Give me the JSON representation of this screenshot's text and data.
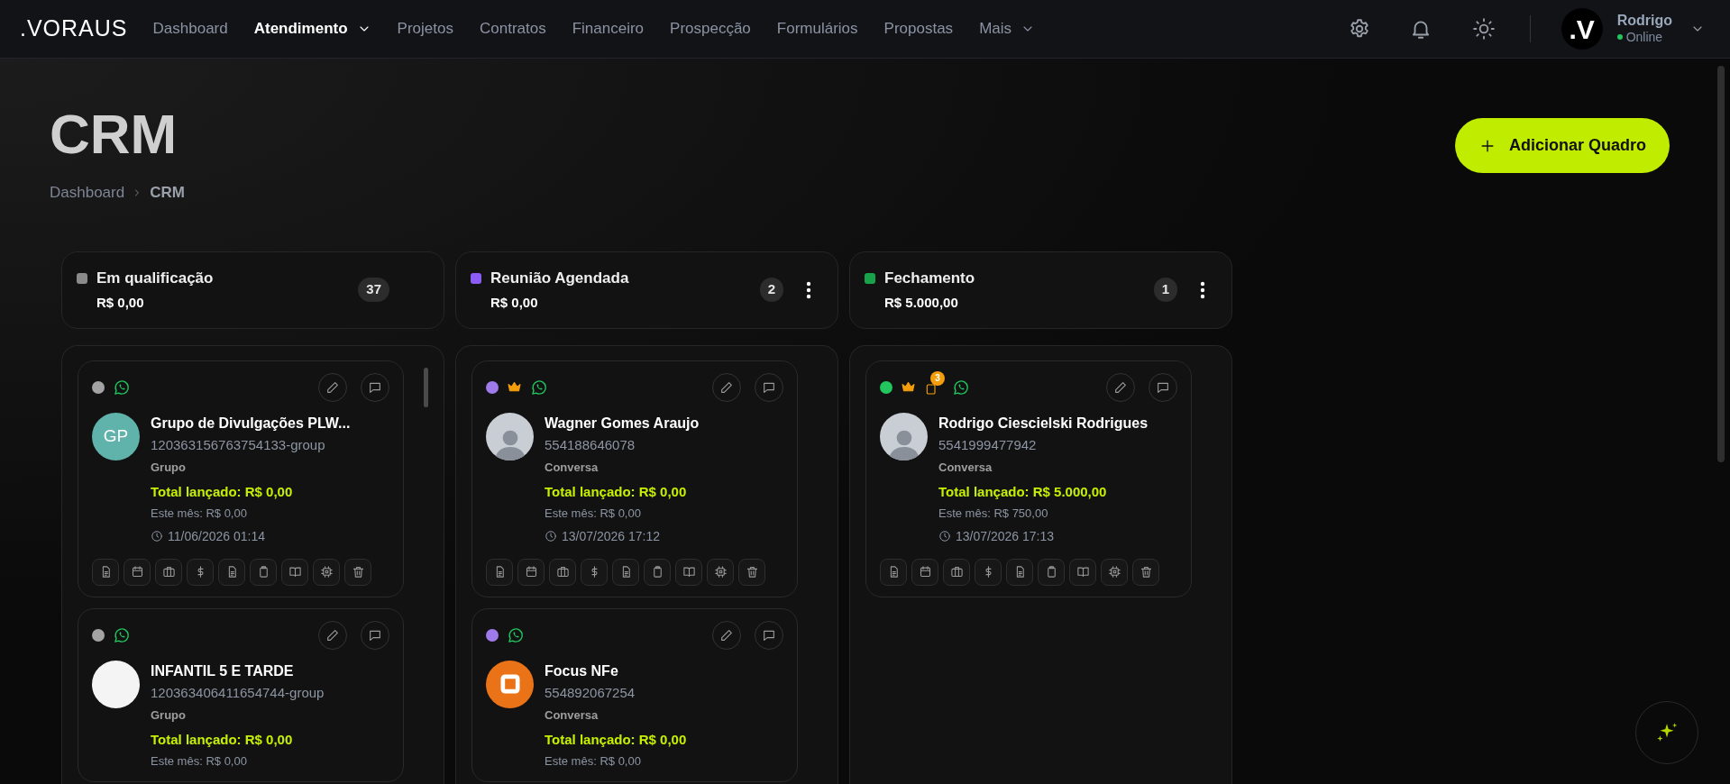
{
  "nav": {
    "logo": ".VORAUS",
    "items": [
      {
        "label": "Dashboard",
        "selected": false,
        "dropdown": false
      },
      {
        "label": "Atendimento",
        "selected": true,
        "dropdown": true
      },
      {
        "label": "Projetos",
        "selected": false,
        "dropdown": false
      },
      {
        "label": "Contratos",
        "selected": false,
        "dropdown": false
      },
      {
        "label": "Financeiro",
        "selected": false,
        "dropdown": false
      },
      {
        "label": "Prospecção",
        "selected": false,
        "dropdown": false
      },
      {
        "label": "Formulários",
        "selected": false,
        "dropdown": false
      },
      {
        "label": "Propostas",
        "selected": false,
        "dropdown": false
      },
      {
        "label": "Mais",
        "selected": false,
        "dropdown": true
      }
    ]
  },
  "user": {
    "avatar": ".V",
    "name": "Rodrigo",
    "status": "Online",
    "online": true
  },
  "page": {
    "title": "CRM",
    "breadcrumb": [
      "Dashboard",
      "CRM"
    ],
    "add_button": "Adicionar Quadro"
  },
  "columns": [
    {
      "title": "Em qualificação",
      "total": "R$ 0,00",
      "count": "37",
      "color": "#8a8a8a",
      "menu": false,
      "cards": [
        {
          "color": "#a3a3a3",
          "premium": false,
          "avatar": {
            "kind": "initials",
            "text": "GP",
            "color": "#5fb3aa"
          },
          "name": "Grupo de Divulgações PLW...",
          "phone": "120363156763754133-group",
          "type": "Grupo",
          "total": "Total lançado: R$ 0,00",
          "month": "Este mês: R$ 0,00",
          "date": "11/06/2026 01:14"
        },
        {
          "color": "#a3a3a3",
          "premium": false,
          "avatar": {
            "kind": "picture"
          },
          "name": "INFANTIL 5 E TARDE",
          "phone": "120363406411654744-group",
          "type": "Grupo",
          "total": "Total lançado: R$ 0,00",
          "month": "Este mês: R$ 0,00"
        }
      ]
    },
    {
      "title": "Reunião Agendada",
      "total": "R$ 0,00",
      "count": "2",
      "color": "#8b5cf6",
      "menu": true,
      "cards": [
        {
          "color": "#9f7aea",
          "premium": true,
          "avatar": {
            "kind": "photo"
          },
          "name": "Wagner Gomes Araujo",
          "phone": "554188646078",
          "type": "Conversa",
          "total": "Total lançado: R$ 0,00",
          "month": "Este mês: R$ 0,00",
          "date": "13/07/2026 17:12"
        },
        {
          "color": "#9f7aea",
          "premium": false,
          "avatar": {
            "kind": "logo"
          },
          "name": "Focus NFe",
          "phone": "554892067254",
          "type": "Conversa",
          "total": "Total lançado: R$ 0,00",
          "month": "Este mês: R$ 0,00"
        }
      ]
    },
    {
      "title": "Fechamento",
      "total": "R$ 5.000,00",
      "count": "1",
      "color": "#16a34a",
      "menu": true,
      "cards": [
        {
          "color": "#22c55e",
          "premium": true,
          "notes_count": "3",
          "avatar": {
            "kind": "photo"
          },
          "name": "Rodrigo Ciescielski Rodrigues",
          "phone": "5541999477942",
          "type": "Conversa",
          "total": "Total lançado: R$ 5.000,00",
          "month": "Este mês: R$ 750,00",
          "date": "13/07/2026 17:13"
        }
      ]
    }
  ]
}
